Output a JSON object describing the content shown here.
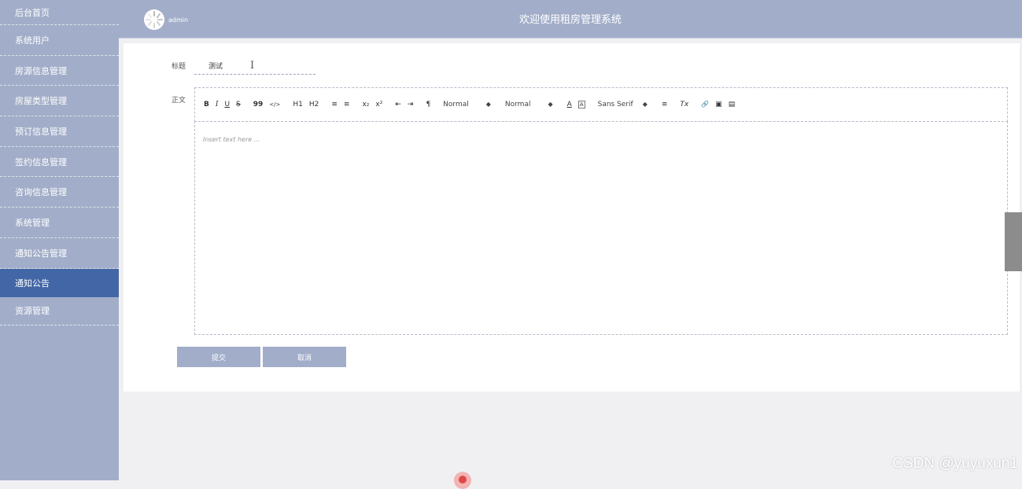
{
  "sidebar": {
    "items": [
      {
        "label": "后台首页"
      },
      {
        "label": "系统用户"
      },
      {
        "label": "房源信息管理"
      },
      {
        "label": "房屋类型管理"
      },
      {
        "label": "预订信息管理"
      },
      {
        "label": "签约信息管理"
      },
      {
        "label": "咨询信息管理"
      },
      {
        "label": "系统管理"
      },
      {
        "label": "通知公告管理"
      },
      {
        "label": "通知公告"
      },
      {
        "label": "资源管理"
      }
    ],
    "active_index": 9
  },
  "header": {
    "username": "admin",
    "title": "欢迎使用租房管理系统"
  },
  "form": {
    "title_label": "标题",
    "title_value": "测试",
    "body_label": "正文",
    "editor_placeholder": "Insert text here ...",
    "submit_label": "提交",
    "cancel_label": "取消"
  },
  "toolbar": {
    "bold": "B",
    "italic": "I",
    "underline": "U",
    "strike": "S",
    "quote": "99",
    "code": "</>",
    "h1": "H1",
    "h2": "H2",
    "ordered_list": "≡",
    "bullet_list": "≡",
    "subscript": "x₂",
    "superscript": "x²",
    "outdent": "⇤",
    "indent": "⇥",
    "direction": "¶",
    "size_select": "Normal",
    "header_select": "Normal",
    "font_color": "A",
    "background_color": "A",
    "font_select": "Sans Serif",
    "align": "≡",
    "clean": "Tx",
    "link": "🔗",
    "image": "▣",
    "video": "▤"
  },
  "watermark": "CSDN @yuyuxun1",
  "colors": {
    "sidebar_bg": "#a2aec9",
    "sidebar_active": "#4366a6",
    "button_bg": "#a2aec9"
  }
}
